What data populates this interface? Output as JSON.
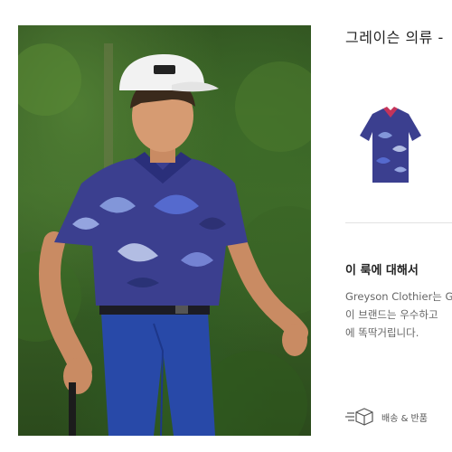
{
  "hero": {
    "image": "golfer-in-blue-floral-polo",
    "colors": {
      "shirt": "#3b3f8f",
      "pants": "#2849a8",
      "cap": "#f2f2f2",
      "foliage": "#3f6a2a"
    }
  },
  "product": {
    "title": "그레이슨 의류 -",
    "thumbnail": "floral-polo-shirt-thumbnail"
  },
  "about": {
    "heading": "이 룩에 대해서",
    "lines": [
      "Greyson Clothier는 Go",
      "이 브랜드는 우수하고",
      "에 똑딱거립니다."
    ]
  },
  "shipping": {
    "icon": "shipping-box-icon",
    "label": "배송 & 반품"
  }
}
